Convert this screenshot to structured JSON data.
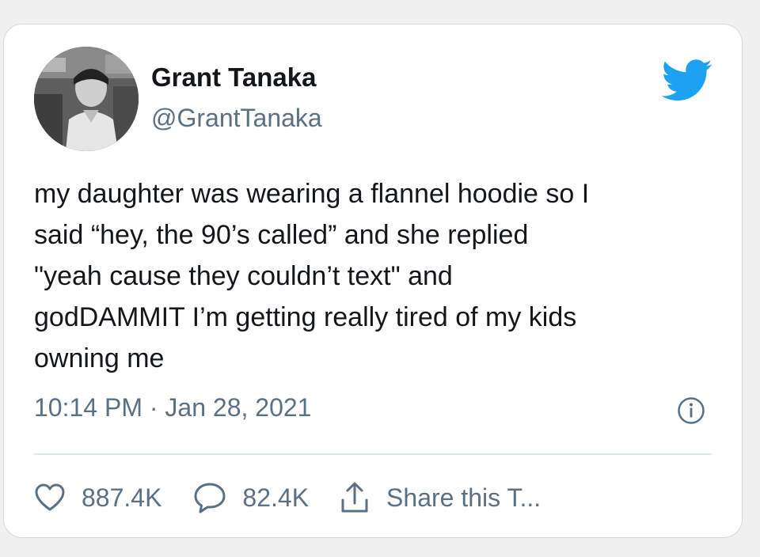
{
  "author": {
    "display_name": "Grant Tanaka",
    "handle": "@GrantTanaka",
    "avatar_icon": "profile-photo"
  },
  "brand": {
    "icon": "twitter-bird-icon",
    "color": "#1da1f2"
  },
  "tweet": {
    "text": "my daughter was wearing a flannel hoodie so I\nsaid “hey, the 90’s called” and she replied\n\"yeah cause they couldn’t text\" and\ngodDAMMIT I’m getting really tired of my kids\nowning me",
    "timestamp": "10:14 PM · Jan 28, 2021"
  },
  "actions": {
    "likes": "887.4K",
    "replies": "82.4K",
    "share_label": "Share this T..."
  },
  "colors": {
    "text_primary": "#14171a",
    "text_secondary": "#5b7083",
    "divider": "#e1e8ed"
  }
}
